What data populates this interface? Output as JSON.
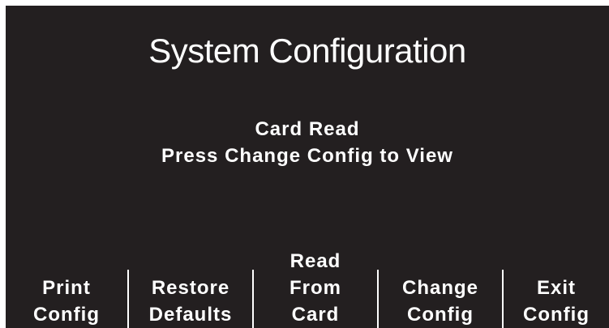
{
  "screen": {
    "title": "System Configuration",
    "message": {
      "line1": "Card Read",
      "line2": "Press Change Config to View"
    }
  },
  "softkeys": [
    {
      "lines": [
        "Print",
        "Config"
      ]
    },
    {
      "lines": [
        "Restore",
        "Defaults"
      ]
    },
    {
      "lines": [
        "Read",
        "From",
        "Card"
      ]
    },
    {
      "lines": [
        "Change",
        "Config"
      ]
    },
    {
      "lines": [
        "Exit",
        "Config"
      ]
    }
  ],
  "colors": {
    "background": "#231f20",
    "text": "#ffffff"
  }
}
